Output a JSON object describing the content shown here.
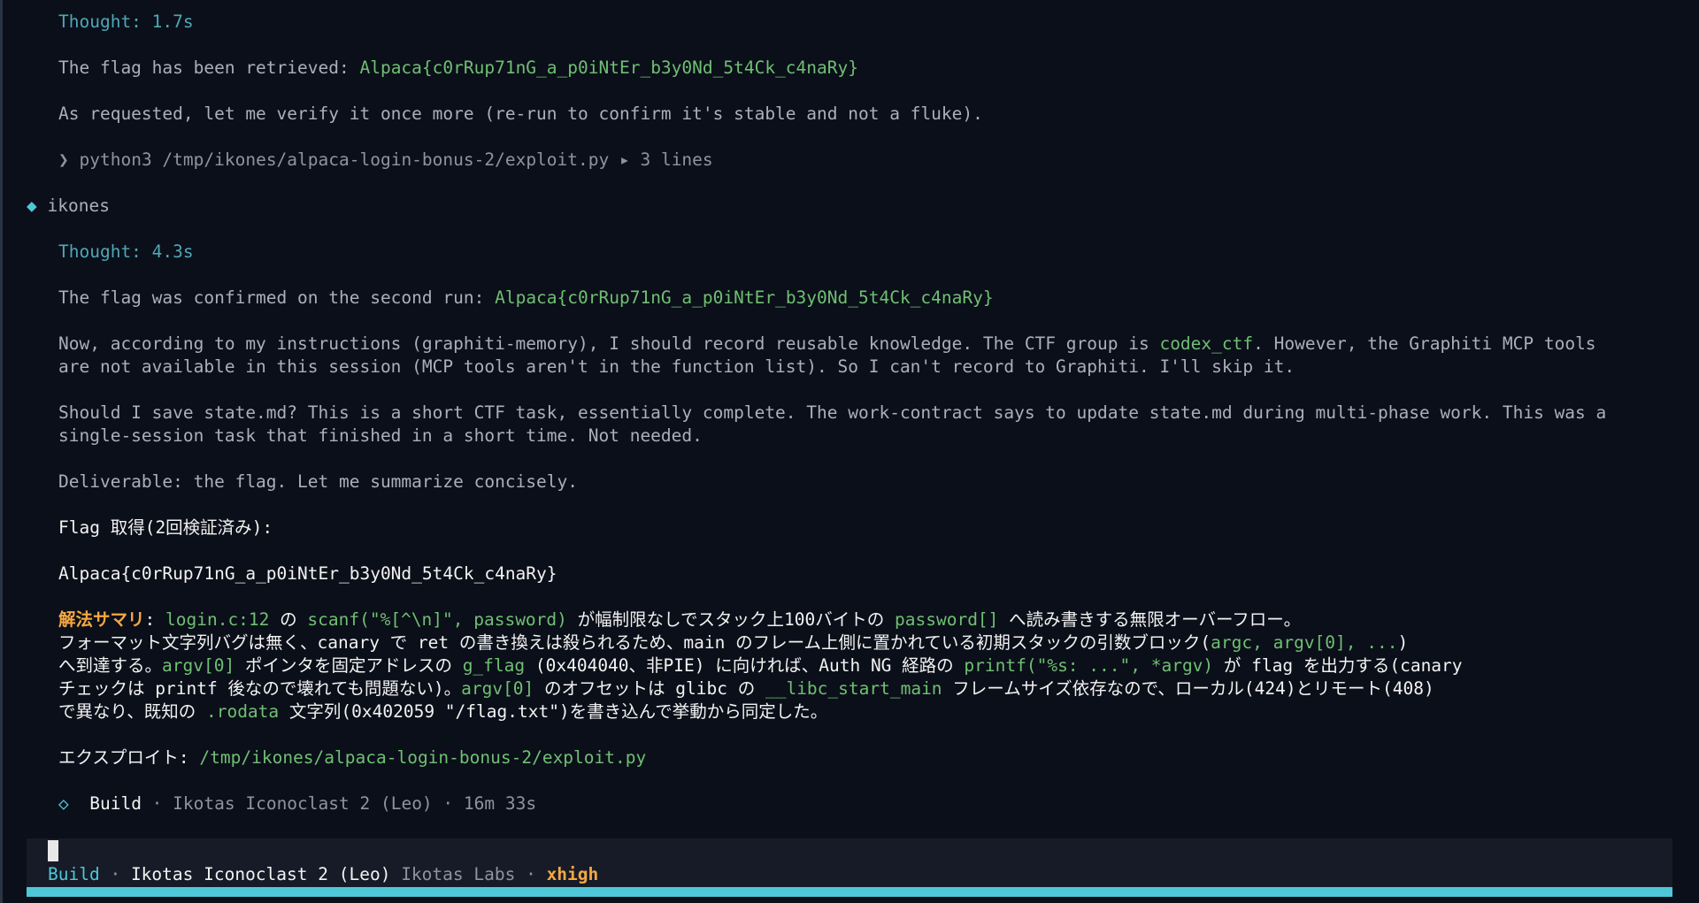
{
  "transcript": {
    "thought1": "Thought: 1.7s",
    "flag_retrieved_prefix": "The flag has been retrieved: ",
    "flag": "Alpaca{c0rRup71nG_a_p0iNtEr_b3y0Nd_5t4Ck_c4naRy}",
    "verify_text": "As requested, let me verify it once more (re-run to confirm it's stable and not a fluke).",
    "command_prompt": "❯",
    "command": "python3 /tmp/ikones/alpaca-login-bonus-2/exploit.py",
    "command_suffix": " ▸ 3 lines",
    "user_icon": "◆",
    "user": "ikones",
    "thought2": "Thought: 4.3s",
    "confirmed_prefix": "The flag was confirmed on the second run: ",
    "memory_line1_a": "Now, according to my instructions (graphiti-memory), I should record reusable knowledge. The CTF group is ",
    "memory_group": "codex_ctf",
    "memory_line1_b": ". However, the Graphiti MCP tools",
    "memory_line2": "are not available in this session (MCP tools aren't in the function list). So I can't record to Graphiti. I'll skip it.",
    "state_line1": "Should I save state.md? This is a short CTF task, essentially complete. The work-contract says to update state.md during multi-phase work. This was a",
    "state_line2": "single-session task that finished in a short time. Not needed.",
    "deliverable": "Deliverable: the flag. Let me summarize concisely."
  },
  "answer": {
    "flag_heading": "Flag 取得(2回検証済み):",
    "flag": "Alpaca{c0rRup71nG_a_p0iNtEr_b3y0Nd_5t4Ck_c4naRy}",
    "summary_label": "解法サマリ",
    "s1": {
      "a": ": ",
      "b": "login.c:12",
      "c": " の ",
      "d": "scanf(\"%[^\\n]\", password)",
      "e": " が幅制限なしでスタック上100バイトの ",
      "f": "password[]",
      "g": " へ読み書きする無限オーバーフロー。"
    },
    "s2": {
      "a": "フォーマット文字列バグは無く、canary で ret の書き換えは殺られるため、main のフレーム上側に置かれている初期スタックの引数ブロック(",
      "b": "argc, argv[0], ...",
      "c": ")"
    },
    "s3": {
      "a": "へ到達する。",
      "b": "argv[0]",
      "c": " ポインタを固定アドレスの ",
      "d": "g_flag",
      "e": " (0x404040、非PIE) に向ければ、Auth NG 経路の ",
      "f": "printf(\"%s: ...\", *argv)",
      "g": " が flag を出力する(canary"
    },
    "s4": {
      "a": "チェックは printf 後なので壊れても問題ない)。",
      "b": "argv[0]",
      "c": " のオフセットは glibc の ",
      "d": "__libc_start_main",
      "e": " フレームサイズ依存なので、ローカル(424)とリモート(408)"
    },
    "s5": {
      "a": "で異なり、既知の ",
      "b": ".rodata",
      "c": " 文字列(0x402059 \"/flag.txt\")を書き込んで挙動から同定した。"
    },
    "exploit_label": "エクスプロイト: ",
    "exploit_path": "/tmp/ikones/alpaca-login-bonus-2/exploit.py"
  },
  "build_meta": {
    "icon": "◇",
    "mode": "Build",
    "sep": " · ",
    "model": "Ikotas Iconoclast 2 (Leo)",
    "time": "16m 33s"
  },
  "status_bar": {
    "mode": "Build",
    "sep": " · ",
    "model": "Ikotas Iconoclast 2 (Leo)",
    "provider": "Ikotas Labs",
    "effort": "xhigh"
  },
  "colors": {
    "background": "#0b0f19",
    "accent": "#4fc7d9",
    "green": "#6fbf73",
    "orange": "#f5a742"
  }
}
